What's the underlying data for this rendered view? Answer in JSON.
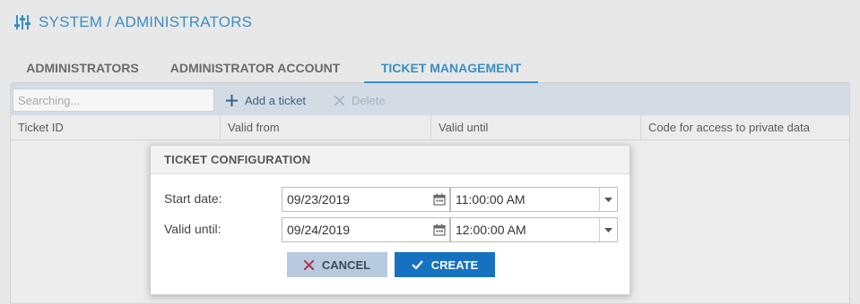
{
  "header": {
    "title": "SYSTEM / ADMINISTRATORS",
    "icon": "sliders-icon"
  },
  "tabs": [
    {
      "label": "ADMINISTRATORS",
      "active": false
    },
    {
      "label": "ADMINISTRATOR ACCOUNT",
      "active": false
    },
    {
      "label": "TICKET MANAGEMENT",
      "active": true
    }
  ],
  "toolbar": {
    "search_placeholder": "Searching...",
    "add_label": "Add a ticket",
    "delete_label": "Delete"
  },
  "table": {
    "columns": [
      "Ticket ID",
      "Valid from",
      "Valid until",
      "Code for access to private data"
    ]
  },
  "dialog": {
    "title": "TICKET CONFIGURATION",
    "start": {
      "label": "Start date:",
      "date": "09/23/2019",
      "time": "11:00:00 AM"
    },
    "until": {
      "label": "Valid until:",
      "date": "09/24/2019",
      "time": "12:00:00 AM"
    },
    "cancel_label": "CANCEL",
    "create_label": "CREATE"
  },
  "colors": {
    "accent": "#3a8fc4",
    "primary_button": "#1672c0",
    "cancel_button": "#b8cadd",
    "cancel_icon": "#b03050"
  }
}
